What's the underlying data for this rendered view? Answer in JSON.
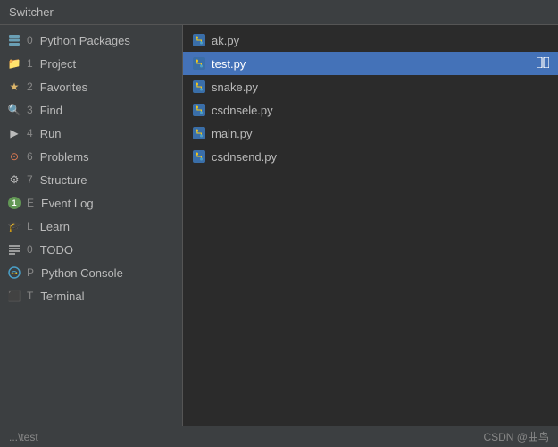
{
  "title": "Switcher",
  "sidebar": {
    "items": [
      {
        "id": "python-packages",
        "shortcut": "0",
        "label": "Python Packages",
        "icon": "layers-icon"
      },
      {
        "id": "project",
        "shortcut": "1",
        "label": "Project",
        "icon": "folder-icon"
      },
      {
        "id": "favorites",
        "shortcut": "2",
        "label": "Favorites",
        "icon": "star-icon"
      },
      {
        "id": "find",
        "shortcut": "3",
        "label": "Find",
        "icon": "search-icon"
      },
      {
        "id": "run",
        "shortcut": "4",
        "label": "Run",
        "icon": "run-icon"
      },
      {
        "id": "problems",
        "shortcut": "6",
        "label": "Problems",
        "icon": "problems-icon"
      },
      {
        "id": "structure",
        "shortcut": "7",
        "label": "Structure",
        "icon": "structure-icon"
      },
      {
        "id": "event-log",
        "shortcut": "E",
        "label": "Event Log",
        "icon": "eventlog-icon"
      },
      {
        "id": "learn",
        "shortcut": "L",
        "label": "Learn",
        "icon": "learn-icon"
      },
      {
        "id": "todo",
        "shortcut": "0",
        "label": "TODO",
        "icon": "todo-icon"
      },
      {
        "id": "python-console",
        "shortcut": "P",
        "label": "Python Console",
        "icon": "console-icon"
      },
      {
        "id": "terminal",
        "shortcut": "T",
        "label": "Terminal",
        "icon": "terminal-icon"
      }
    ]
  },
  "files": {
    "items": [
      {
        "name": "ak.py",
        "selected": false
      },
      {
        "name": "test.py",
        "selected": true,
        "split": true
      },
      {
        "name": "snake.py",
        "selected": false
      },
      {
        "name": "csdnsele.py",
        "selected": false
      },
      {
        "name": "main.py",
        "selected": false
      },
      {
        "name": "csdnsend.py",
        "selected": false
      }
    ]
  },
  "status_bar": {
    "path": "...\\test",
    "credit": "CSDN @曲鸟"
  }
}
